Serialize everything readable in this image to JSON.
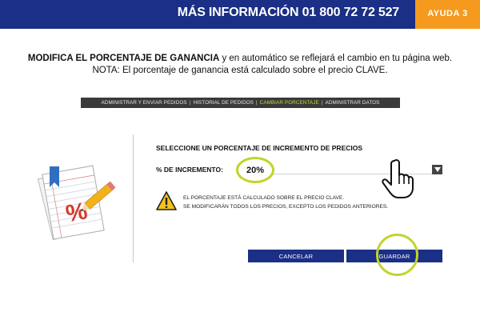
{
  "header": {
    "info_text": "MÁS INFORMACIÓN  01 800 72 72 527",
    "help_label": "AYUDA 3",
    "colors": {
      "blue": "#1b2f86",
      "orange": "#f59a1e"
    }
  },
  "intro": {
    "bold": "MODIFICA EL PORCENTAJE DE GANANCIA",
    "rest": " y en automático se reflejará el cambio en tu página web.",
    "note": "NOTA: El porcentaje de ganancia está calculado sobre el precio CLAVE."
  },
  "nav": {
    "items": [
      {
        "label": "ADMINISTRAR Y ENVIAR PEDIDOS"
      },
      {
        "label": "HISTORIAL DE PEDIDOS"
      },
      {
        "label": "CAMBIAR PORCENTAJE"
      },
      {
        "label": "ADMINISTRAR DATOS"
      }
    ],
    "active_index": 2,
    "separator": "|"
  },
  "illustration": {
    "icon": "percent-notepad-pencil-icon",
    "symbol": "%"
  },
  "form": {
    "section_title": "SELECCIONE UN PORCENTAJE DE INCREMENTO DE PRECIOS",
    "increment_label": "% DE INCREMENTO:",
    "increment_value": "20%",
    "dropdown_icon": "caret-down-icon",
    "warning": {
      "icon": "warning-triangle-icon",
      "line1": "EL PORCENTAJE ESTÁ CALCULADO SOBRE EL PRECIO CLAVE.",
      "line2": "SE MODIFICARÁN TODOS LOS PRECIOS, EXCEPTO LOS PEDIDOS ANTERIORES."
    },
    "cursor_icon": "hand-pointer-icon",
    "cancel_label": "CANCELAR",
    "save_label": "GUARDAR",
    "highlight_color": "#c2d42b"
  }
}
